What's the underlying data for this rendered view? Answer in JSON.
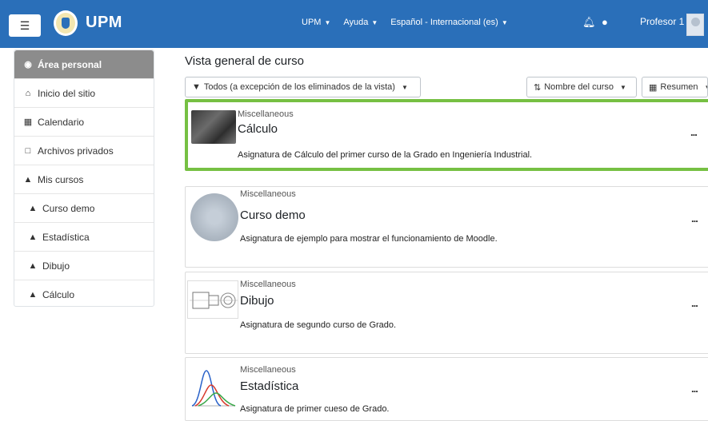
{
  "topbar": {
    "brand": "UPM",
    "nav": [
      {
        "label": "UPM"
      },
      {
        "label": "Ayuda"
      },
      {
        "label": "Español - Internacional (es)"
      }
    ],
    "user": "Profesor 1"
  },
  "sidebar": {
    "items": [
      {
        "label": "Área personal",
        "icon": "dashboard-icon"
      },
      {
        "label": "Inicio del sitio",
        "icon": "home-icon"
      },
      {
        "label": "Calendario",
        "icon": "calendar-icon"
      },
      {
        "label": "Archivos privados",
        "icon": "file-icon"
      },
      {
        "label": "Mis cursos",
        "icon": "graduation-cap-icon"
      },
      {
        "label": "Curso demo",
        "icon": "graduation-cap-icon"
      },
      {
        "label": "Estadística",
        "icon": "graduation-cap-icon"
      },
      {
        "label": "Dibujo",
        "icon": "graduation-cap-icon"
      },
      {
        "label": "Cálculo",
        "icon": "graduation-cap-icon"
      }
    ]
  },
  "main": {
    "title": "Vista general de curso",
    "filter_label": "Todos (a excepción de los eliminados de la vista)",
    "sort_label": "Nombre del curso",
    "view_label": "Resumen",
    "courses": [
      {
        "category": "Miscellaneous",
        "name": "Cálculo",
        "description": "Asignatura de Cálculo del primer curso de la Grado en Ingeniería Industrial."
      },
      {
        "category": "Miscellaneous",
        "name": "Curso demo",
        "description": "Asignatura de ejemplo para mostrar el funcionamiento de Moodle."
      },
      {
        "category": "Miscellaneous",
        "name": "Dibujo",
        "description": "Asignatura de segundo curso de Grado."
      },
      {
        "category": "Miscellaneous",
        "name": "Estadística",
        "description": "Asignatura de primer cueso de Grado."
      }
    ],
    "more_label": "..."
  },
  "colors": {
    "topbar": "#2a6fb9",
    "active_sidebar": "#8c8c8c",
    "selected_border": "#76c043"
  }
}
